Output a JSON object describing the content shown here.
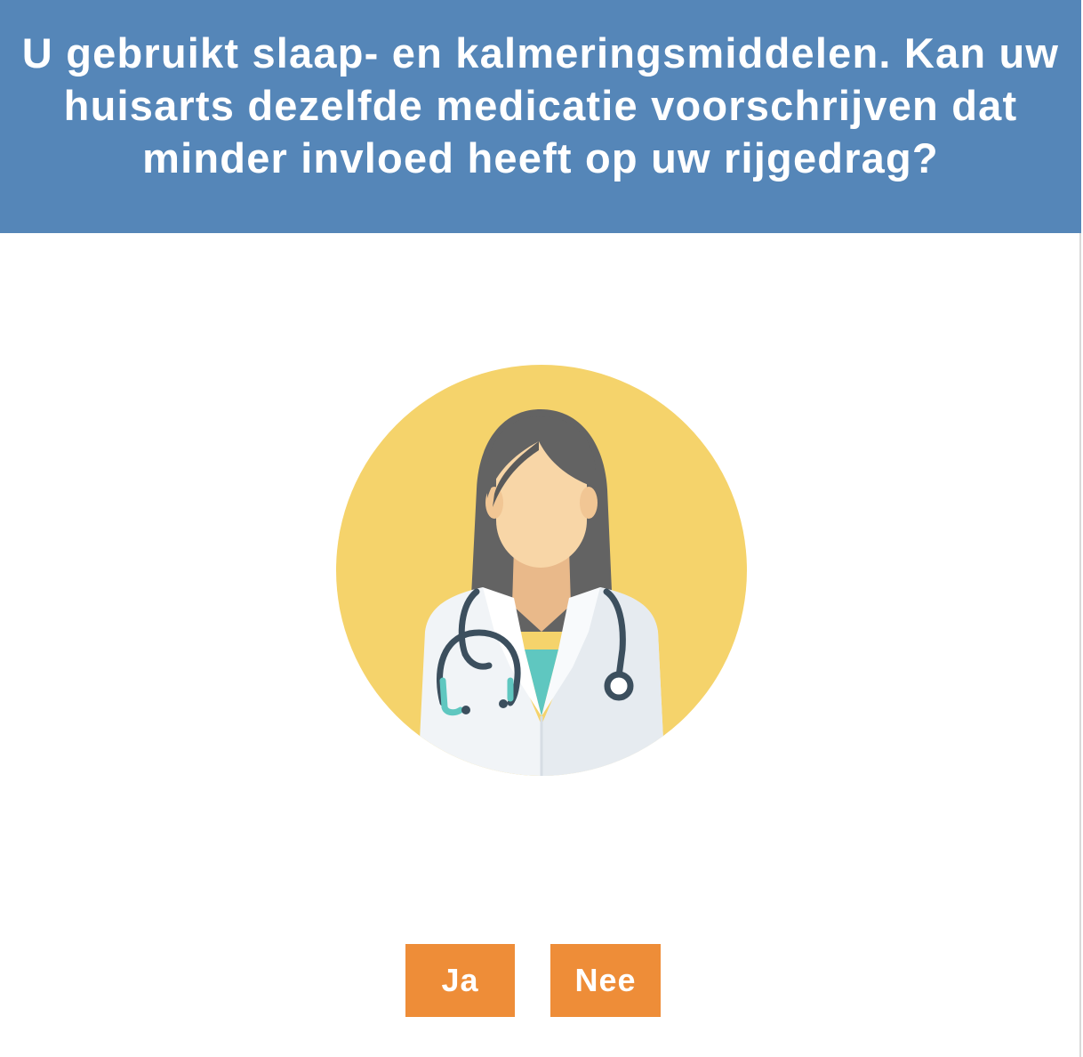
{
  "header": {
    "question": "U gebruikt slaap- en kalmeringsmiddelen. Kan uw huisarts dezelfde medicatie voorschrijven dat minder invloed heeft op uw rijgedrag?",
    "background_color": "#5586b8"
  },
  "illustration": {
    "icon": "doctor-icon",
    "circle_color": "#f5d36b"
  },
  "answers": {
    "yes_label": "Ja",
    "no_label": "Nee",
    "button_color": "#ee8d38"
  }
}
